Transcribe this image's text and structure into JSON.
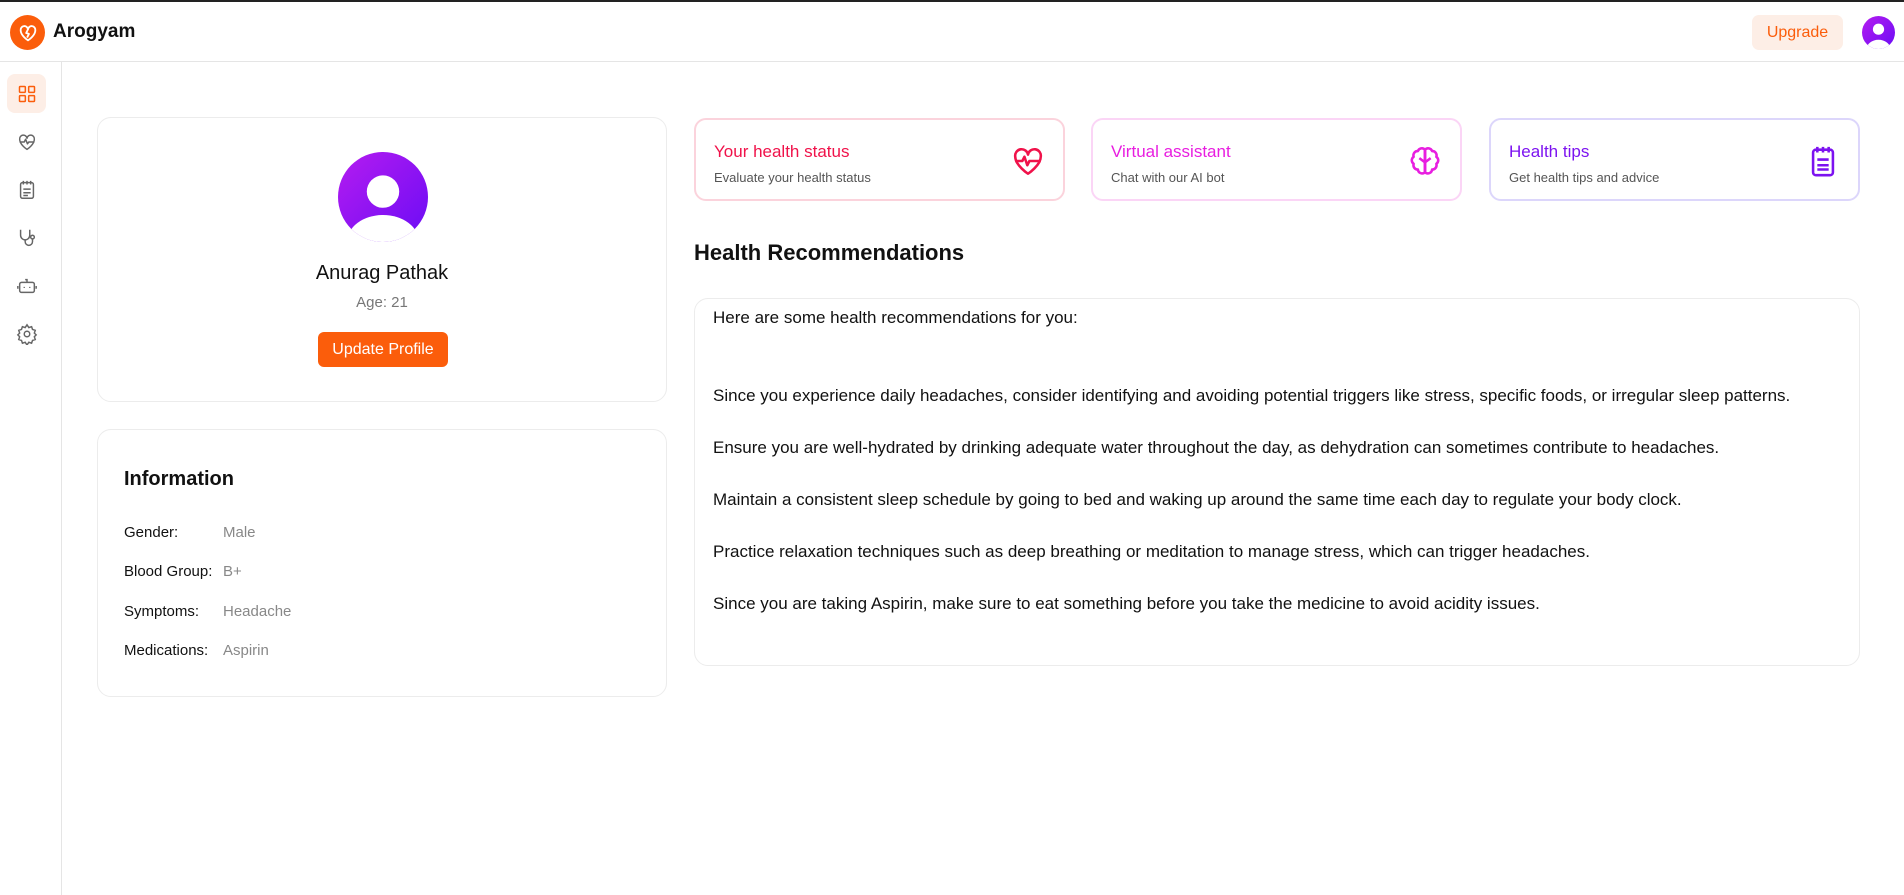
{
  "app": {
    "name": "Arogyam",
    "logo_icon": "broken-heart-icon",
    "accent": "#fb5d0b"
  },
  "header": {
    "upgrade_label": "Upgrade",
    "avatar_icon": "user-avatar-icon"
  },
  "sidebar": {
    "items": [
      {
        "name": "dashboard",
        "icon": "grid-icon",
        "active": true
      },
      {
        "name": "health",
        "icon": "heart-pulse-icon"
      },
      {
        "name": "tips",
        "icon": "notepad-icon"
      },
      {
        "name": "doctor",
        "icon": "stethoscope-icon"
      },
      {
        "name": "assistant",
        "icon": "bot-icon"
      },
      {
        "name": "settings",
        "icon": "gear-icon"
      }
    ]
  },
  "profile": {
    "name": "Anurag Pathak",
    "age": "Age: 21",
    "update_label": "Update Profile"
  },
  "information": {
    "title": "Information",
    "rows": [
      {
        "label": "Gender:",
        "value": "Male"
      },
      {
        "label": "Blood Group:",
        "value": "B+"
      },
      {
        "label": "Symptoms:",
        "value": "Headache"
      },
      {
        "label": "Medications:",
        "value": "Aspirin"
      }
    ]
  },
  "actions": [
    {
      "title": "Your health status",
      "subtitle": "Evaluate your health status",
      "icon": "heart-pulse-icon",
      "color": "#f0124a",
      "border": "#fbd3dc"
    },
    {
      "title": "Virtual assistant",
      "subtitle": "Chat with our AI bot",
      "icon": "brain-icon",
      "color": "#e81ee0",
      "border": "#fbd5f6"
    },
    {
      "title": "Health tips",
      "subtitle": "Get health tips and advice",
      "icon": "notepad-icon",
      "color": "#7c12f0",
      "border": "#dcd6fb"
    }
  ],
  "recommendations": {
    "title": "Health Recommendations",
    "intro": "Here are some health recommendations for you:",
    "items": [
      "Since you experience daily headaches, consider identifying and avoiding potential triggers like stress, specific foods, or irregular sleep patterns.",
      "Ensure you are well-hydrated by drinking adequate water throughout the day, as dehydration can sometimes contribute to headaches.",
      "Maintain a consistent sleep schedule by going to bed and waking up around the same time each day to regulate your body clock.",
      "Practice relaxation techniques such as deep breathing or meditation to manage stress, which can trigger headaches.",
      "Since you are taking Aspirin, make sure to eat something before you take the medicine to avoid acidity issues."
    ]
  }
}
